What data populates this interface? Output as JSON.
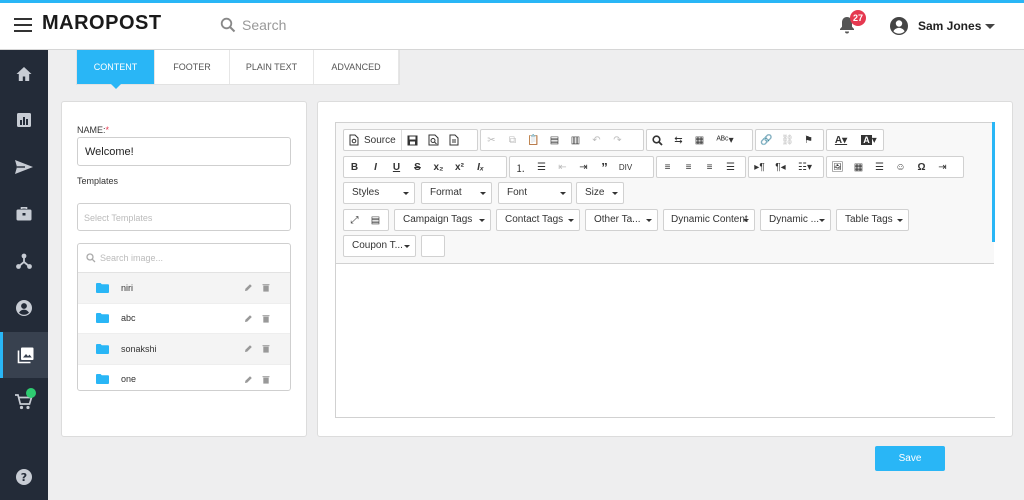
{
  "header": {
    "logo": "MAROPOST",
    "search_placeholder": "Search",
    "notification_count": "27",
    "user_name": "Sam Jones"
  },
  "sidebar": {
    "items": [
      {
        "icon": "home-icon"
      },
      {
        "icon": "chart-icon"
      },
      {
        "icon": "send-icon"
      },
      {
        "icon": "briefcase-icon"
      },
      {
        "icon": "journey-icon"
      },
      {
        "icon": "account-icon"
      },
      {
        "icon": "gallery-icon",
        "active": true
      },
      {
        "icon": "cart-icon"
      },
      {
        "icon": "help-icon"
      }
    ]
  },
  "tabs": [
    "CONTENT",
    "FOOTER",
    "PLAIN TEXT",
    "ADVANCED"
  ],
  "form": {
    "name_label": "NAME:",
    "required_mark": "*",
    "name_value": "Welcome!",
    "templates_label": "Templates",
    "templates_placeholder": "Select Templates",
    "image_search_placeholder": "Search image..."
  },
  "folders": [
    {
      "name": "niri"
    },
    {
      "name": "abc"
    },
    {
      "name": "sonakshi"
    },
    {
      "name": "one"
    }
  ],
  "editor": {
    "source_label": "Source",
    "styles_label": "Styles",
    "format_label": "Format",
    "font_label": "Font",
    "size_label": "Size",
    "campaign_tags_label": "Campaign Tags",
    "contact_tags_label": "Contact Tags",
    "other_tags_label": "Other Ta...",
    "dynamic_content_label": "Dynamic Content",
    "dynamic_label": "Dynamic ...",
    "table_tags_label": "Table Tags",
    "coupon_label": "Coupon T..."
  },
  "save_label": "Save",
  "colors": {
    "accent": "#29b6f6",
    "sidebar": "#232b38",
    "badge": "#e53950",
    "cart_dot": "#2ecc71"
  }
}
